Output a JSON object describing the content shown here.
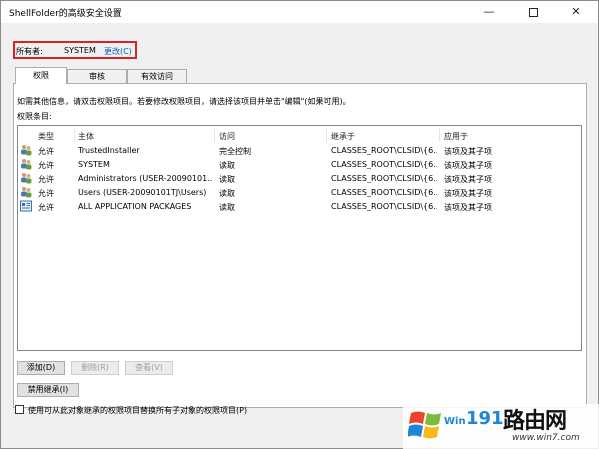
{
  "window": {
    "title": "ShellFolder的高级安全设置",
    "minimize_glyph": "—",
    "close_glyph": "✕"
  },
  "owner": {
    "label": "所有者:",
    "value": "SYSTEM",
    "change_link": "更改(C)"
  },
  "tabs": [
    {
      "label": "权限",
      "active": true
    },
    {
      "label": "审核",
      "active": false
    },
    {
      "label": "有效访问",
      "active": false
    }
  ],
  "info_text": "如需其他信息，请双击权限项目。若要修改权限项目，请选择该项目并单击\"编辑\"(如果可用)。",
  "entries_label": "权限条目:",
  "columns": [
    "类型",
    "主体",
    "访问",
    "继承于",
    "应用于"
  ],
  "rows": [
    {
      "type": "允许",
      "principal": "TrustedInstaller",
      "access": "完全控制",
      "inherited": "CLASSES_ROOT\\CLSID\\{6...",
      "applies": "该项及其子项",
      "icon": "user-group-icon"
    },
    {
      "type": "允许",
      "principal": "SYSTEM",
      "access": "读取",
      "inherited": "CLASSES_ROOT\\CLSID\\{6...",
      "applies": "该项及其子项",
      "icon": "user-group-icon"
    },
    {
      "type": "允许",
      "principal": "Administrators (USER-20090101...",
      "access": "读取",
      "inherited": "CLASSES_ROOT\\CLSID\\{6...",
      "applies": "该项及其子项",
      "icon": "user-group-icon"
    },
    {
      "type": "允许",
      "principal": "Users (USER-20090101TJ\\Users)",
      "access": "读取",
      "inherited": "CLASSES_ROOT\\CLSID\\{6...",
      "applies": "该项及其子项",
      "icon": "user-group-icon"
    },
    {
      "type": "允许",
      "principal": "ALL APPLICATION PACKAGES",
      "access": "读取",
      "inherited": "CLASSES_ROOT\\CLSID\\{6...",
      "applies": "该项及其子项",
      "icon": "app-packages-icon"
    }
  ],
  "buttons": {
    "add": "添加(D)",
    "remove": "删除(R)",
    "view": "查看(V)",
    "disable_inheritance": "禁用继承(I)"
  },
  "checkbox_label": "使用可从此对象继承的权限项目替换所有子对象的权限项目(P)",
  "watermark": {
    "number": "191",
    "chinese": "路由网",
    "url": "www.win7.com",
    "os_text": "Win"
  },
  "colors": {
    "highlight_border": "#d9232a",
    "link": "#0563c1",
    "watermark_blue": "#1e86d8"
  }
}
